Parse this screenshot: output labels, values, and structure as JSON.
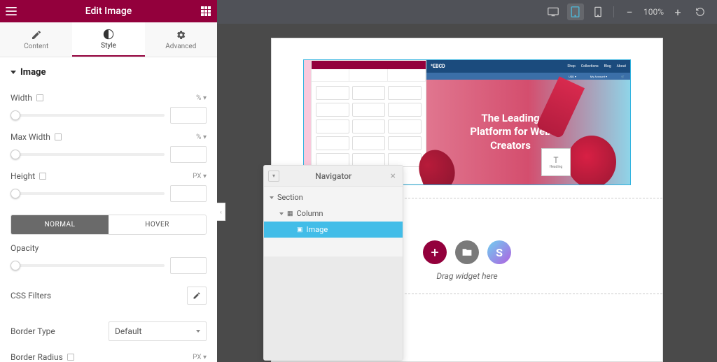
{
  "header": {
    "title": "Edit Image"
  },
  "tabs": {
    "content": "Content",
    "style": "Style",
    "advanced": "Advanced"
  },
  "section": {
    "image_head": "Image"
  },
  "controls": {
    "width_label": "Width",
    "width_unit": "% ▾",
    "maxwidth_label": "Max Width",
    "maxwidth_unit": "% ▾",
    "height_label": "Height",
    "height_unit": "PX ▾",
    "normal": "NORMAL",
    "hover": "HOVER",
    "opacity_label": "Opacity",
    "cssfilters_label": "CSS Filters",
    "bordertype_label": "Border Type",
    "bordertype_value": "Default",
    "borderradius_label": "Border Radius",
    "borderradius_unit": "PX ▾"
  },
  "topbar": {
    "zoom": "100%"
  },
  "preview": {
    "logo": "*EBCD",
    "nav": [
      "Shop",
      "Collections",
      "Blog",
      "About"
    ],
    "sub": [
      "USD ▾",
      "My Account ▾",
      "🛒"
    ],
    "headline": "The Leading Platform for Web Creators",
    "card_letter": "T",
    "card_caption": "Heading"
  },
  "widget_drop": {
    "label": "Drag widget here"
  },
  "navigator": {
    "title": "Navigator",
    "section": "Section",
    "column": "Column",
    "image": "Image"
  }
}
